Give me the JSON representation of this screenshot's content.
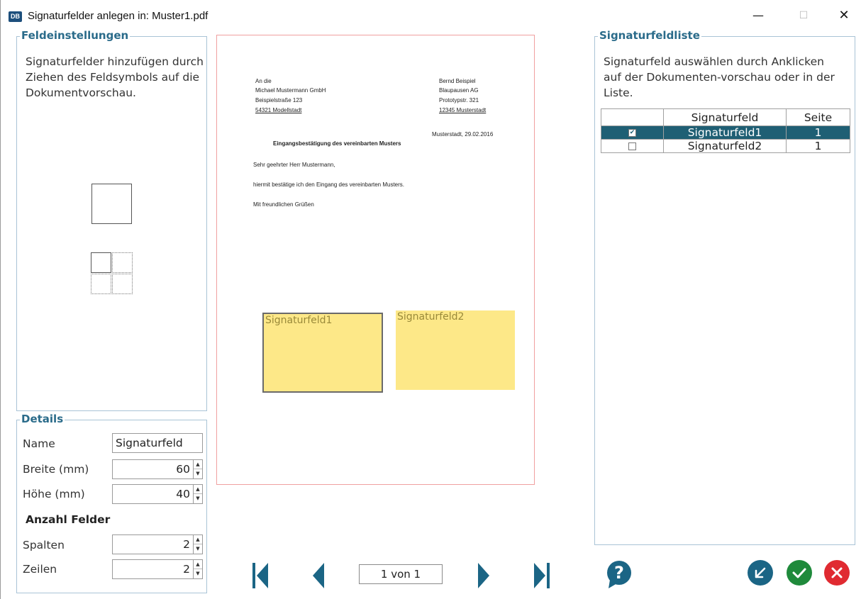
{
  "window": {
    "logo_text": "DB",
    "title": "Signaturfelder anlegen in: Muster1.pdf"
  },
  "field_settings": {
    "title": "Feldeinstellungen",
    "help": "Signaturfelder hinzufügen durch Ziehen des Feldsymbols auf die Dokumentvorschau."
  },
  "details": {
    "title": "Details",
    "name_label": "Name",
    "name_value": "Signaturfeld",
    "width_label": "Breite (mm)",
    "width_value": "60",
    "height_label": "Höhe (mm)",
    "height_value": "40",
    "count_heading": "Anzahl Felder",
    "columns_label": "Spalten",
    "columns_value": "2",
    "rows_label": "Zeilen",
    "rows_value": "2"
  },
  "document": {
    "recipient": [
      "An die",
      "Michael Mustermann GmbH",
      "Beispielstraße 123",
      "54321 Modellstadt"
    ],
    "sender": [
      "Bernd Beispiel",
      "Blaupausen AG",
      "Prototypstr. 321",
      "12345 Musterstadt"
    ],
    "date_line": "Musterstadt, 29.02.2016",
    "subject": "Eingangsbestätigung des vereinbarten Musters",
    "salutation": "Sehr geehrter Herr Mustermann,",
    "body": "hiermit bestätige ich den Eingang des vereinbarten Musters.",
    "closing": "Mit freundlichen Grüßen",
    "sig_fields": [
      "Signaturfeld1",
      "Signaturfeld2"
    ]
  },
  "signature_list": {
    "title": "Signaturfeldliste",
    "help": "Signaturfeld auswählen durch Anklicken auf der Dokumenten-vorschau oder in der Liste.",
    "columns": [
      "",
      "Signaturfeld",
      "Seite"
    ],
    "rows": [
      {
        "checked": true,
        "name": "Signaturfeld1",
        "page": "1",
        "selected": true
      },
      {
        "checked": false,
        "name": "Signaturfeld2",
        "page": "1",
        "selected": false
      }
    ]
  },
  "navigation": {
    "page_indicator": "1 von 1"
  },
  "icons": {
    "first": "first-page-icon",
    "prev": "prev-page-icon",
    "next": "next-page-icon",
    "last": "last-page-icon",
    "help": "help-icon",
    "import": "import-arrow-icon",
    "ok": "checkmark-icon",
    "cancel": "close-x-icon"
  },
  "colors": {
    "accent": "#1b6585",
    "group_title": "#2a6b8a",
    "selected_row": "#1f5f74",
    "sig_field": "#fde888",
    "ok": "#1f8a3b",
    "cancel": "#e02a31"
  }
}
